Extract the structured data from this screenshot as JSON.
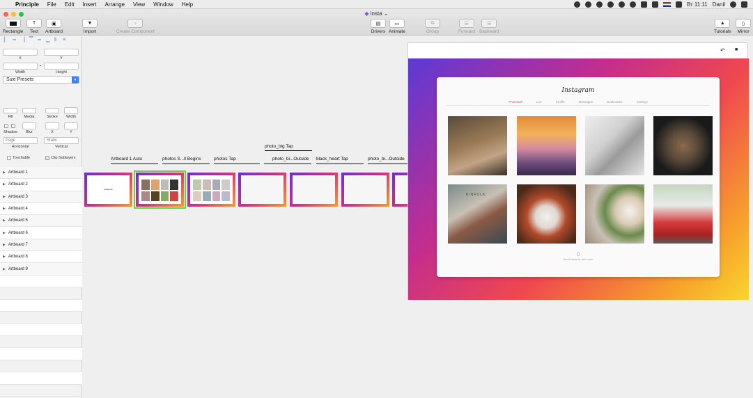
{
  "menubar": {
    "app": "Principle",
    "items": [
      "File",
      "Edit",
      "Insert",
      "Arrange",
      "View",
      "Window",
      "Help"
    ],
    "clock": "Вт 11:11",
    "user": "Danil"
  },
  "window": {
    "title": "insta"
  },
  "toolbar": {
    "rectangle": "Rectangle",
    "text": "Text",
    "artboard": "Artboard",
    "import": "Import",
    "create_component": "Create Component",
    "drivers": "Drivers",
    "animate": "Animate",
    "group": "Group",
    "forward": "Forward",
    "backward": "Backward",
    "tutorials": "Tutorials",
    "mirror": "Mirror"
  },
  "inspector": {
    "x_label": "X",
    "y_label": "Y",
    "width_label": "Width",
    "height_label": "Height",
    "size_presets": "Size Presets",
    "fill": "Fill",
    "media": "Media",
    "stroke": "Stroke",
    "stroke_width": "Width",
    "shadow": "Shadow",
    "blur": "Blur",
    "pos_x": "X",
    "pos_y": "Y",
    "horizontal_value": "Page",
    "horizontal_label": "Horizontal",
    "vertical_value": "Static",
    "vertical_label": "Vertical",
    "touchable": "Touchable",
    "clip_sublayers": "Clip Sublayers",
    "text_a": "T",
    "text_b": "T"
  },
  "layers": [
    "Artboard 1",
    "Artboard 2",
    "Artboard 3",
    "Artboard 4",
    "Artboard 5",
    "Artboard 6",
    "Artboard 7",
    "Artboard 8",
    "Artboard 9"
  ],
  "interactions": {
    "a1": "Artboard 1 Auto",
    "a2": "photos S...ll Begins",
    "a3": "photos Tap",
    "a4": "photo_big Tap",
    "a5": "photo_bi...Outside",
    "a6": "black_heart Tap",
    "a7": "photo_bi...Outside"
  },
  "artboard1_text": "Instagram",
  "preview": {
    "brand": "Instagram",
    "tabs": [
      "Photowall",
      "Live",
      "Profile",
      "Messages",
      "Bookmarks",
      "Settings"
    ],
    "scroll_count": "0",
    "scroll_hint": "Scroll down to see more",
    "photo_names": [
      "lion",
      "sunset",
      "white cat",
      "tabby cat",
      "tattooed arm with magazine",
      "woman holding cat",
      "coffee and limes",
      "couple with red car"
    ],
    "kinfolk": "KINFOLK"
  },
  "icons": {
    "undo": "↶",
    "camera": "■"
  }
}
